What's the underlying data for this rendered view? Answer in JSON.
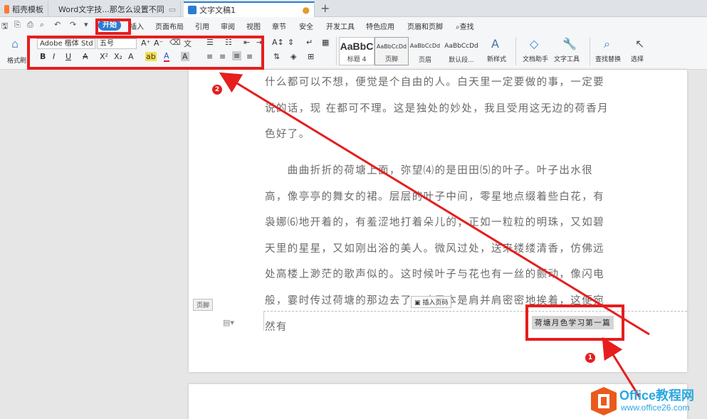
{
  "tabs": [
    {
      "label": "稻壳模板"
    },
    {
      "label": "Word文字技...那怎么设置不同"
    },
    {
      "label": "文字文稿1"
    }
  ],
  "quick_access_more": "▾",
  "menu": {
    "items": [
      "开始",
      "插入",
      "页面布局",
      "引用",
      "审阅",
      "视图",
      "章节",
      "安全",
      "开发工具",
      "特色应用",
      "页眉和页脚"
    ],
    "search": "查找"
  },
  "ribbon": {
    "format_painter": "格式刷",
    "font_name": "Adobe 楷体 Std R",
    "font_size": "五号",
    "bold": "B",
    "italic": "I",
    "underline": "U",
    "strike": "A",
    "superscript": "X²",
    "subscript": "X₂",
    "font_color": "A",
    "clear_format": "A",
    "grow": "A⁺",
    "shrink": "A⁻",
    "styles": [
      {
        "sample": "AaBbC",
        "name": "标题 4"
      },
      {
        "sample": "AaBbCcDd",
        "name": "页脚"
      },
      {
        "sample": "AaBbCcDd",
        "name": "页眉"
      },
      {
        "sample": "AaBbCcDd",
        "name": "默认段..."
      }
    ],
    "new_style": "新样式",
    "doc_assistant": "文档助手",
    "text_tools": "文字工具",
    "find_replace": "查找替换",
    "select": "选择"
  },
  "document": {
    "paragraphs": [
      "什么都可以不想，便觉是个自由的人。白天里一定要做的事，一定要说的话，现 在都可不理。这是独处的妙处，我且受用这无边的荷香月色好了。",
      "　　曲曲折折的荷塘上面，弥望⑷的是田田⑸的叶子。叶子出水很高，像亭亭的舞女的裙。层层的叶子中间，零星地点缀着些白花，有袅娜⑹地开着的，有羞涩地打着朵儿的；正如一粒粒的明珠，又如碧天里的星星，又如刚出浴的美人。微风过处，送来缕缕清香，仿佛远处高楼上渺茫的歌声似的。这时候叶子与花也有一丝的颤动，像闪电般，霎时传过荷塘的那边去了。叶子本是肩并肩密密地挨着，这便宛然有"
    ],
    "footer_label": "页脚",
    "insert_page_number": "插入页码",
    "footer_text": "荷塘月色学习第一篇"
  },
  "annotations": {
    "badge1": "1",
    "badge2": "2",
    "accent": "#e61e1e"
  },
  "watermark": {
    "brand": "Office教程网",
    "url": "www.office26.com"
  }
}
